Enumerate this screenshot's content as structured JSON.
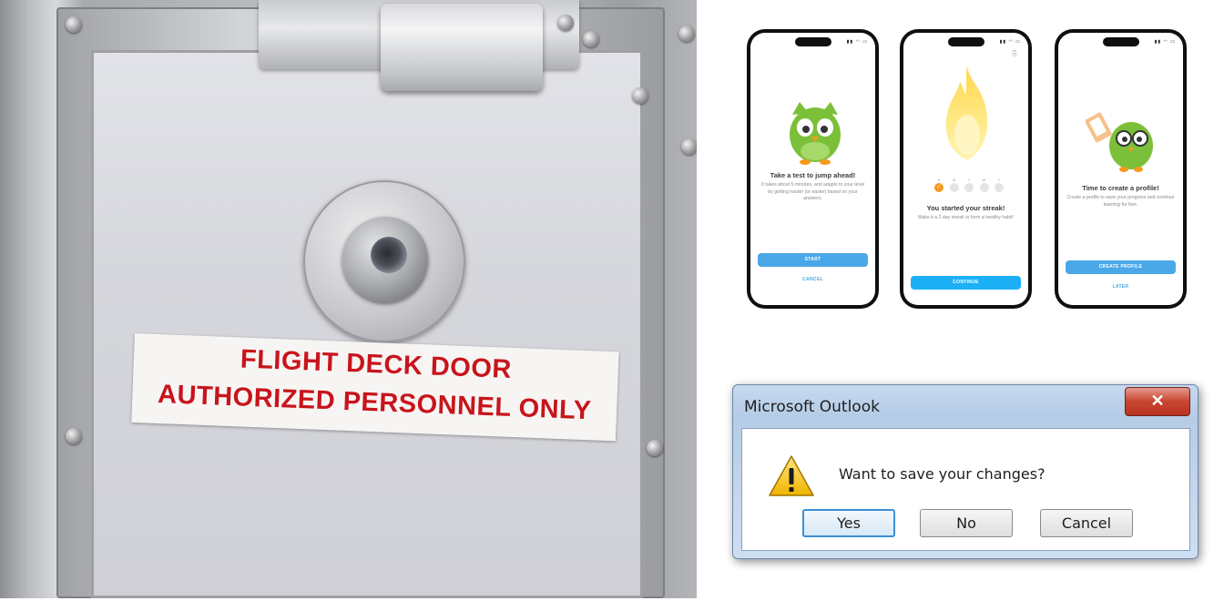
{
  "door_sign": {
    "line1": "FLIGHT DECK DOOR",
    "line2": "AUTHORIZED PERSONNEL ONLY"
  },
  "phones": [
    {
      "title": "Take a test to jump ahead!",
      "body": "It takes about 5 minutes, and adapts to your level by getting harder (or easier) based on your answers.",
      "primary_button": "START",
      "secondary_link": "CANCEL"
    },
    {
      "days": [
        "S",
        "M",
        "T",
        "W",
        "T"
      ],
      "title": "You started your streak!",
      "body": "Make it a 2 day streak to form a healthy habit!",
      "primary_button": "CONTINUE"
    },
    {
      "title": "Time to create a profile!",
      "body": "Create a profile to save your progress and continue learning for free.",
      "primary_button": "CREATE PROFILE",
      "secondary_link": "LATER"
    }
  ],
  "dialog": {
    "title": "Microsoft Outlook",
    "close_glyph": "✕",
    "message": "Want to save your changes?",
    "buttons": {
      "yes": "Yes",
      "no": "No",
      "cancel": "Cancel"
    },
    "icon": "warning-icon"
  },
  "colors": {
    "sign_red": "#c8141c",
    "duo_green": "#7cc03a",
    "duo_blue": "#4aa8e8",
    "streak_orange": "#f59a1c",
    "close_red": "#c8452f"
  }
}
